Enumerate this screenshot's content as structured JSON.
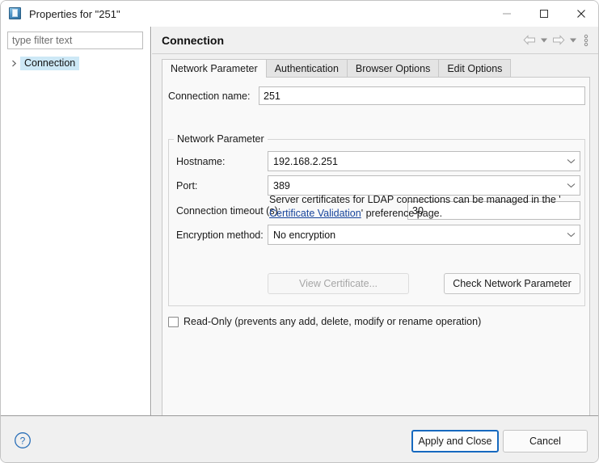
{
  "window": {
    "title": "Properties for \"251\"",
    "icon": "ldap-connection-icon",
    "controls": {
      "minimize": "minimize-button",
      "maximize": "maximize-button",
      "close": "close-button"
    }
  },
  "sidebar": {
    "filter": {
      "placeholder": "type filter text",
      "value": ""
    },
    "items": [
      {
        "label": "Connection",
        "selected": true,
        "expandable": true
      }
    ]
  },
  "page": {
    "title": "Connection",
    "tools": {
      "back": "back-arrow",
      "back_menu": "back-dropdown",
      "forward": "forward-arrow",
      "forward_menu": "forward-dropdown",
      "menu": "view-menu"
    }
  },
  "tabs": [
    {
      "label": "Network Parameter",
      "active": true
    },
    {
      "label": "Authentication",
      "active": false
    },
    {
      "label": "Browser Options",
      "active": false
    },
    {
      "label": "Edit Options",
      "active": false
    }
  ],
  "form": {
    "connection_name": {
      "label": "Connection name:",
      "value": "251"
    },
    "group": {
      "legend": "Network Parameter"
    },
    "hostname": {
      "label": "Hostname:",
      "value": "192.168.2.251"
    },
    "port": {
      "label": "Port:",
      "value": "389"
    },
    "timeout": {
      "label": "Connection timeout (s):",
      "value": "30"
    },
    "encryption": {
      "label": "Encryption method:",
      "value": "No encryption"
    },
    "cert_note": {
      "prefix": "Server certificates for LDAP connections can be managed in the '",
      "link": "Certificate Validation",
      "suffix": "' preference page."
    },
    "view_certificate_button": {
      "label": "View Certificate...",
      "enabled": false
    },
    "check_network_button": {
      "label": "Check Network Parameter",
      "enabled": true
    },
    "read_only": {
      "label": "Read-Only (prevents any add, delete, modify or rename operation)",
      "checked": false
    }
  },
  "footer": {
    "help": "help-icon",
    "apply_label": "Apply and Close",
    "cancel_label": "Cancel"
  },
  "colors": {
    "accent": "#1669bf",
    "link": "#16449c",
    "selection": "#cde8f6",
    "chrome": "#f0f0f0",
    "panel": "#f9f9f9"
  }
}
